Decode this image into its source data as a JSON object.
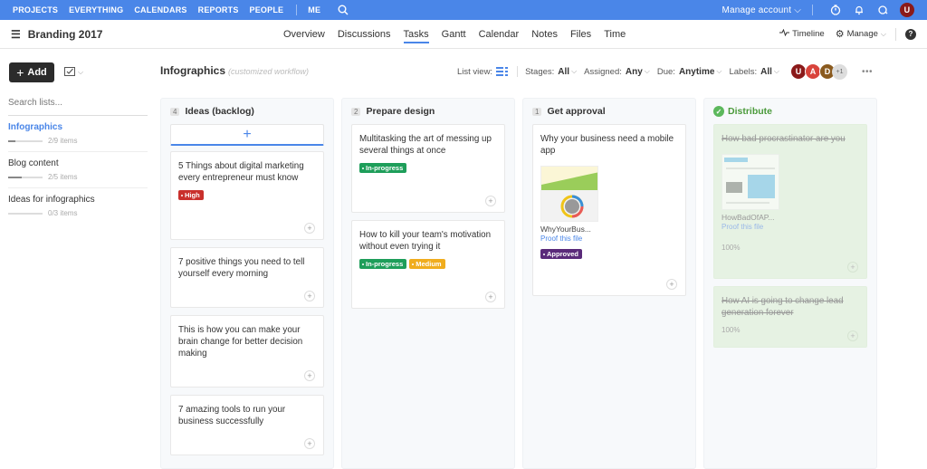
{
  "topnav": {
    "items": [
      "PROJECTS",
      "EVERYTHING",
      "CALENDARS",
      "REPORTS",
      "PEOPLE"
    ],
    "me": "ME",
    "manage_account": "Manage account",
    "user_initial": "U",
    "color": "#4a86e8"
  },
  "header": {
    "project_title": "Branding 2017",
    "tabs": [
      {
        "label": "Overview",
        "active": false
      },
      {
        "label": "Discussions",
        "active": false
      },
      {
        "label": "Tasks",
        "active": true
      },
      {
        "label": "Gantt",
        "active": false
      },
      {
        "label": "Calendar",
        "active": false
      },
      {
        "label": "Notes",
        "active": false
      },
      {
        "label": "Files",
        "active": false
      },
      {
        "label": "Time",
        "active": false
      }
    ],
    "timeline_label": "Timeline",
    "manage_label": "Manage",
    "help_label": "?"
  },
  "toolbar": {
    "add_label": "Add",
    "list_title": "Infographics",
    "list_subtitle": "(customized workflow)",
    "list_view_label": "List view:",
    "filters": {
      "stages_label": "Stages:",
      "stages_value": "All",
      "assigned_label": "Assigned:",
      "assigned_value": "Any",
      "due_label": "Due:",
      "due_value": "Anytime",
      "labels_label": "Labels:",
      "labels_value": "All"
    },
    "members": [
      {
        "initial": "U",
        "color": "#8b1a1a"
      },
      {
        "initial": "A",
        "color": "#d9443c"
      },
      {
        "initial": "D",
        "color": "#8a5a1e"
      }
    ],
    "more_members": "+1",
    "more_menu": "•••"
  },
  "sidebar": {
    "search_placeholder": "Search lists...",
    "lists": [
      {
        "name": "Infographics",
        "count": "2/9 items",
        "progress": 0.22,
        "active": true
      },
      {
        "name": "Blog content",
        "count": "2/5 items",
        "progress": 0.4,
        "active": false
      },
      {
        "name": "Ideas for infographics",
        "count": "0/3 items",
        "progress": 0,
        "active": false
      }
    ]
  },
  "board": {
    "columns": [
      {
        "count": "4",
        "title": "Ideas (backlog)",
        "cards": [
          {
            "title": "5 Things about digital marketing every entrepreneur must know",
            "tags": [
              {
                "label": "High",
                "color": "#c9302c"
              }
            ]
          },
          {
            "title": "7 positive things you need to tell yourself every morning",
            "tags": []
          },
          {
            "title": "This is how you can make your brain change for better decision making",
            "tags": []
          },
          {
            "title": "7 amazing tools to run your business successfully",
            "tags": []
          }
        ]
      },
      {
        "count": "2",
        "title": "Prepare design",
        "cards": [
          {
            "title": "Multitasking the art of messing up several things at once",
            "tags": [
              {
                "label": "In-progress",
                "color": "#1e9e5a"
              }
            ]
          },
          {
            "title": "How to kill your team's motivation without even trying it",
            "tags": [
              {
                "label": "In-progress",
                "color": "#1e9e5a"
              },
              {
                "label": "Medium",
                "color": "#f0ad1e"
              }
            ]
          }
        ]
      },
      {
        "count": "1",
        "title": "Get approval",
        "cards": [
          {
            "title": "Why your business need a mobile app",
            "file": "WhyYourBus...",
            "proof": "Proof this file",
            "tags": [
              {
                "label": "Approved",
                "color": "#5a2a7a"
              }
            ]
          }
        ]
      },
      {
        "title": "Distribute",
        "done": true,
        "cards": [
          {
            "title": "How bad procrastinator are you",
            "file": "HowBadOfAP...",
            "proof": "Proof this file",
            "percent": "100%"
          },
          {
            "title": "How AI is going to change lead generation forever",
            "percent": "100%"
          }
        ]
      }
    ]
  }
}
